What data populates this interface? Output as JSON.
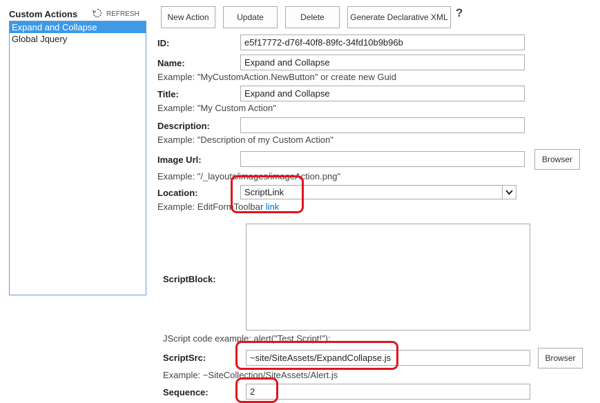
{
  "sidebar": {
    "title": "Custom Actions",
    "refresh_label": "REFRESH",
    "items": [
      {
        "label": "Expand and Collapse",
        "selected": true
      },
      {
        "label": "Global Jquery",
        "selected": false
      }
    ]
  },
  "toolbar": {
    "new_label": "New Action",
    "update_label": "Update",
    "delete_label": "Delete",
    "generate_label": "Generate Declarative XML",
    "help_label": "?"
  },
  "form": {
    "id": {
      "label": "ID:",
      "value": "e5f17772-d76f-40f8-89fc-34fd10b9b96b"
    },
    "name": {
      "label": "Name:",
      "value": "Expand and Collapse",
      "example": "Example: \"MyCustomAction.NewButton\" or create new Guid"
    },
    "title": {
      "label": "Title:",
      "value": "Expand and Collapse",
      "example": "Example: \"My Custom Action\""
    },
    "description": {
      "label": "Description:",
      "value": "",
      "example": "Example: \"Description of my Custom Action\""
    },
    "image_url": {
      "label": "Image Url:",
      "value": "",
      "browser_label": "Browser",
      "example": "Example: \"/_layouts/images/imageAction.png\""
    },
    "location": {
      "label": "Location:",
      "value": "ScriptLink",
      "example_prefix": "Example: EditFormToolbar",
      "example_link": "link"
    },
    "script_block": {
      "label": "ScriptBlock:",
      "value": "",
      "example": "JScript code example: alert(\"Test Script!\");"
    },
    "script_src": {
      "label": "ScriptSrc:",
      "value": "~site/SiteAssets/ExpandCollapse.js",
      "browser_label": "Browser",
      "example": "Example: ~SiteCollection/SiteAssets/Alert.js"
    },
    "sequence": {
      "label": "Sequence:",
      "value": "2"
    }
  },
  "colors": {
    "accent": "#3e99e6",
    "link": "#0072c6",
    "highlight": "#e0141c"
  }
}
